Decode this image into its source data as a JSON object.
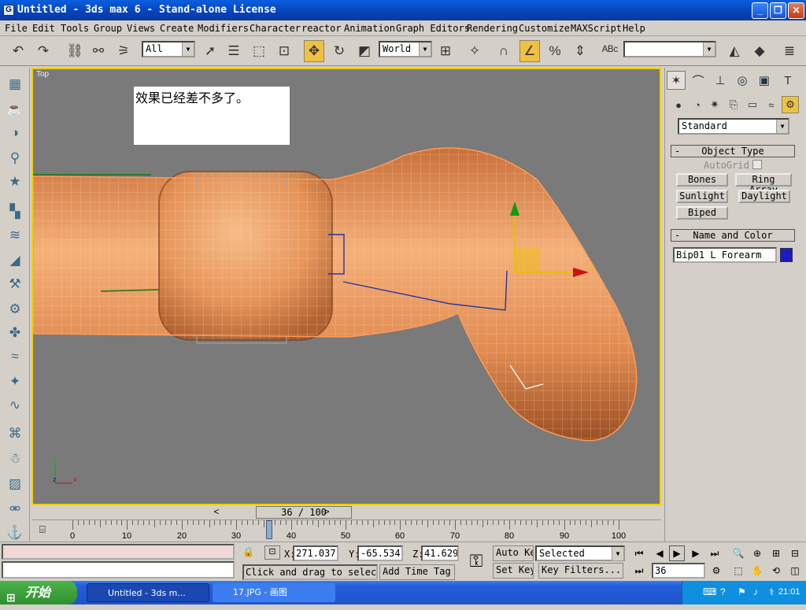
{
  "window": {
    "title": "Untitled - 3ds max 6 - Stand-alone License",
    "app_icon": "3ds-max-icon",
    "minimize": "_",
    "restore": "❐",
    "close": "✕"
  },
  "menu": [
    "File",
    "Edit",
    "Tools",
    "Group",
    "Views",
    "Create",
    "Modifiers",
    "Character",
    "reactor",
    "Animation",
    "Graph Editors",
    "Rendering",
    "Customize",
    "MAXScript",
    "Help"
  ],
  "toolbar": {
    "selection_filter": "All",
    "reference_coord": "World",
    "named_selection": ""
  },
  "viewport": {
    "label": "Top",
    "note": "效果已经差不多了。",
    "colors": {
      "border": "#f0d000",
      "background": "#7a7a7a",
      "mesh": "#e8935a",
      "wire": "#ffb27a"
    }
  },
  "command_panel": {
    "category": "Standard",
    "object_type_title": "Object Type",
    "autogrid": "AutoGrid",
    "buttons": [
      "Bones",
      "Ring Array",
      "Sunlight",
      "Daylight",
      "Biped"
    ],
    "name_color_title": "Name and Color",
    "object_name": "Bip01 L Forearm",
    "object_color": "#1a1ac8",
    "collapse_symbol": "-"
  },
  "time": {
    "slider_label": "36 / 100",
    "ticks": [
      "0",
      "10",
      "20",
      "30",
      "40",
      "50",
      "60",
      "70",
      "80",
      "90",
      "100"
    ],
    "current_frame": 36,
    "total_frames": 100,
    "prev": "<",
    "next": ">"
  },
  "status": {
    "x_label": "X:",
    "x": "271.037",
    "y_label": "Y:",
    "y": "-65.534",
    "z_label": "Z:",
    "z": "41.629",
    "prompt": "Click and drag to select",
    "add_time_tag": "Add Time Tag",
    "auto_key": "Auto Key",
    "set_key": "Set Key",
    "key_mode": "Selected",
    "key_filters": "Key Filters...",
    "frame_field": "36"
  },
  "taskbar": {
    "start": "开始",
    "tasks": [
      "Untitled - 3ds m...",
      "17.JPG - 画图"
    ],
    "clock": "21:01"
  }
}
